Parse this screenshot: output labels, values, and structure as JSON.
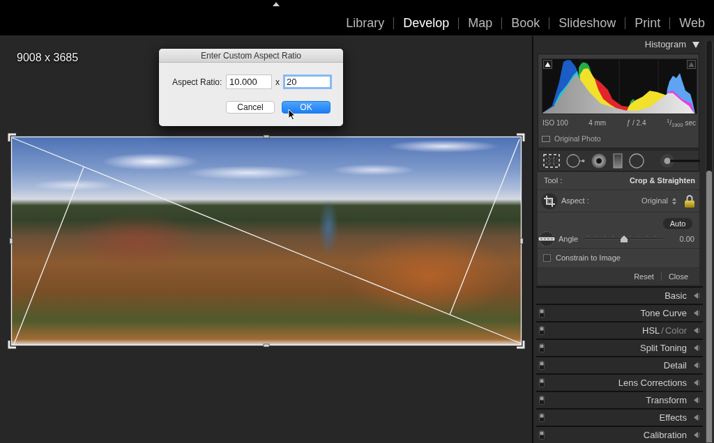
{
  "module_picker": {
    "modules": [
      {
        "label": "Library",
        "selected": false
      },
      {
        "label": "Develop",
        "selected": true
      },
      {
        "label": "Map",
        "selected": false
      },
      {
        "label": "Book",
        "selected": false
      },
      {
        "label": "Slideshow",
        "selected": false
      },
      {
        "label": "Print",
        "selected": false
      },
      {
        "label": "Web",
        "selected": false
      }
    ]
  },
  "canvas": {
    "image_size": "9008 x 3685"
  },
  "dialog": {
    "title": "Enter Custom Aspect Ratio",
    "label": "Aspect Ratio:",
    "fields": [
      {
        "value": "10.000",
        "focused": false
      },
      {
        "value": "20",
        "focused": true
      }
    ],
    "separator": "x",
    "buttons": [
      {
        "label": "Cancel",
        "kind": "cancel"
      },
      {
        "label": "OK",
        "kind": "default"
      }
    ]
  },
  "histogram": {
    "title": "Histogram",
    "clip_indicators": [
      {
        "kind": "shadows",
        "on": true
      },
      {
        "kind": "highlights",
        "on": false
      }
    ],
    "info": [
      "ISO 100",
      "4 mm",
      "ƒ / 2.4",
      "$^{1}$/$_{1900}$ sec"
    ],
    "original_photo": {
      "label": "Original Photo",
      "checked": false
    }
  },
  "tool_strip": {
    "tools": [
      {
        "kind": "crop",
        "selected": true
      },
      {
        "kind": "spot",
        "selected": false
      },
      {
        "kind": "redeye",
        "selected": false
      },
      {
        "kind": "graduated",
        "selected": false
      },
      {
        "kind": "radial",
        "selected": false
      },
      {
        "kind": "brush",
        "selected": false
      }
    ]
  },
  "crop_panel": {
    "tool_label": "Tool :",
    "tool_name": "Crop & Straighten",
    "aspect_label": "Aspect :",
    "aspect_value": "Original",
    "aspect_locked": true,
    "auto_label": "Auto",
    "angle_label": "Angle",
    "angle": {
      "level": 0.5
    },
    "angle_value": "0.00",
    "constrain": {
      "label": "Constrain to Image",
      "checked": false
    },
    "actions": [
      "Reset",
      "Close"
    ]
  },
  "panels": [
    {
      "kind": "single",
      "title": "Basic",
      "has_switch": false
    },
    {
      "kind": "single",
      "title": "Tone Curve",
      "has_switch": true
    },
    {
      "kind": "tabs",
      "parts": [
        {
          "text": "HSL",
          "selected": true
        },
        {
          "text": "Color",
          "selected": false
        }
      ],
      "separator": "/",
      "has_switch": true
    },
    {
      "kind": "single",
      "title": "Split Toning",
      "has_switch": true
    },
    {
      "kind": "single",
      "title": "Detail",
      "has_switch": true
    },
    {
      "kind": "single",
      "title": "Lens Corrections",
      "has_switch": true
    },
    {
      "kind": "single",
      "title": "Transform",
      "has_switch": true
    },
    {
      "kind": "single",
      "title": "Effects",
      "has_switch": true
    },
    {
      "kind": "single",
      "title": "Calibration",
      "has_switch": true
    }
  ]
}
